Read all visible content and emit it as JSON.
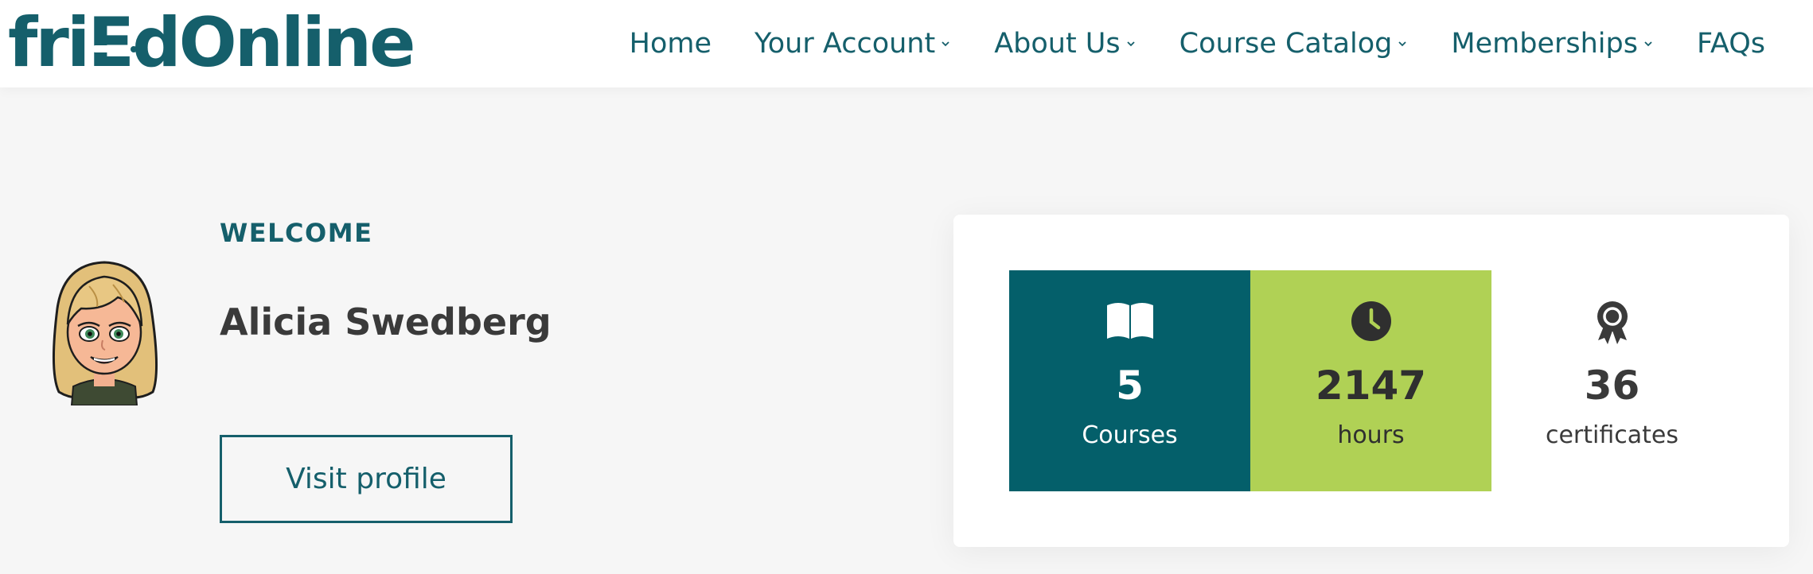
{
  "brand": {
    "logo_pre": "fri",
    "logo_e": "E",
    "logo_post": "dOnline",
    "color_primary": "#155f6b",
    "color_accent": "#b0d155"
  },
  "nav": {
    "items": [
      {
        "label": "Home",
        "has_dropdown": false
      },
      {
        "label": "Your Account",
        "has_dropdown": true
      },
      {
        "label": "About Us",
        "has_dropdown": true
      },
      {
        "label": "Course Catalog",
        "has_dropdown": true
      },
      {
        "label": "Memberships",
        "has_dropdown": true
      },
      {
        "label": "FAQs",
        "has_dropdown": false
      }
    ]
  },
  "welcome": {
    "heading": "WELCOME",
    "name": "Alicia Swedberg",
    "button": "Visit profile",
    "avatar_icon": "bitmoji-avatar"
  },
  "stats": {
    "courses": {
      "value": "5",
      "label": "Courses",
      "icon": "book-icon"
    },
    "hours": {
      "value": "2147",
      "label": "hours",
      "icon": "clock-icon"
    },
    "certificates": {
      "value": "36",
      "label": "certificates",
      "icon": "award-ribbon-icon"
    }
  }
}
